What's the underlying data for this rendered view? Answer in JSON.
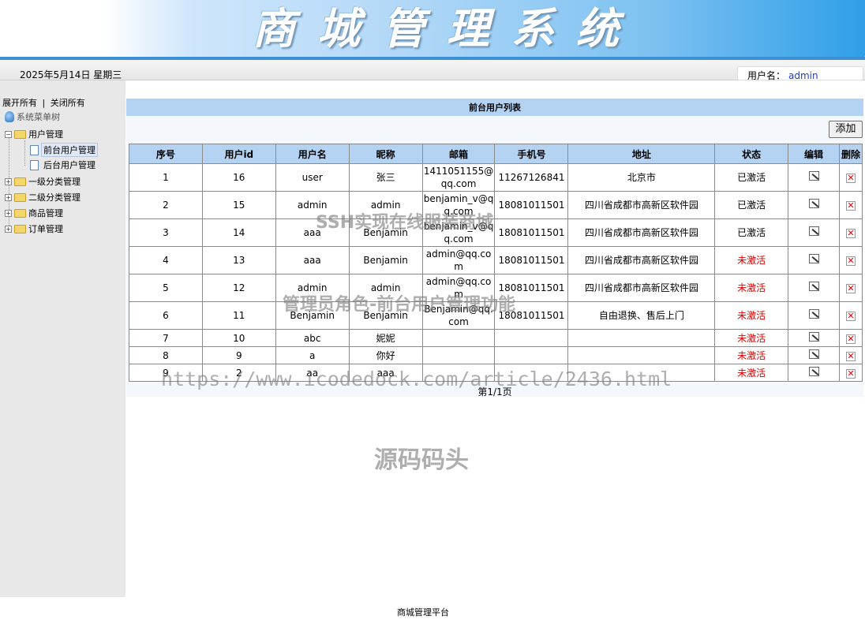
{
  "header": {
    "title": "商城管理系统"
  },
  "infobar": {
    "date": "2025年5月14日 星期三",
    "user_label": "用户名：",
    "username": "admin"
  },
  "sidebar": {
    "expand_all": "展开所有",
    "separator": "|",
    "collapse_all": "关闭所有",
    "root": "系统菜单树",
    "items": [
      {
        "label": "用户管理",
        "toggle": "−"
      },
      {
        "label": "前台用户管理"
      },
      {
        "label": "后台用户管理"
      },
      {
        "label": "一级分类管理",
        "toggle": "+"
      },
      {
        "label": "二级分类管理",
        "toggle": "+"
      },
      {
        "label": "商品管理",
        "toggle": "+"
      },
      {
        "label": "订单管理",
        "toggle": "+"
      }
    ]
  },
  "main": {
    "list_title": "前台用户列表",
    "add_button": "添加",
    "columns": [
      "序号",
      "用户id",
      "用户名",
      "昵称",
      "邮箱",
      "手机号",
      "地址",
      "状态",
      "编辑",
      "删除"
    ],
    "rows": [
      {
        "no": "1",
        "id": "16",
        "username": "user",
        "nickname": "张三",
        "email": "1411051155@qq.com",
        "phone": "11267126841",
        "address": "北京市",
        "status": "已激活",
        "active": true
      },
      {
        "no": "2",
        "id": "15",
        "username": "admin",
        "nickname": "admin",
        "email": "benjamin_v@qq.com",
        "phone": "18081011501",
        "address": "四川省成都市高新区软件园",
        "status": "已激活",
        "active": true
      },
      {
        "no": "3",
        "id": "14",
        "username": "aaa",
        "nickname": "Benjamin",
        "email": "benjamin_v@qq.com",
        "phone": "18081011501",
        "address": "四川省成都市高新区软件园",
        "status": "已激活",
        "active": true
      },
      {
        "no": "4",
        "id": "13",
        "username": "aaa",
        "nickname": "Benjamin",
        "email": "admin@qq.com",
        "phone": "18081011501",
        "address": "四川省成都市高新区软件园",
        "status": "未激活",
        "active": false
      },
      {
        "no": "5",
        "id": "12",
        "username": "admin",
        "nickname": "admin",
        "email": "admin@qq.com",
        "phone": "18081011501",
        "address": "四川省成都市高新区软件园",
        "status": "未激活",
        "active": false
      },
      {
        "no": "6",
        "id": "11",
        "username": "Benjamin",
        "nickname": "Benjamin",
        "email": "Benjamin@qq.com",
        "phone": "18081011501",
        "address": "自由退换、售后上门",
        "status": "未激活",
        "active": false
      },
      {
        "no": "7",
        "id": "10",
        "username": "abc",
        "nickname": "妮妮",
        "email": "",
        "phone": "",
        "address": "",
        "status": "未激活",
        "active": false
      },
      {
        "no": "8",
        "id": "9",
        "username": "a",
        "nickname": "你好",
        "email": "",
        "phone": "",
        "address": "",
        "status": "未激活",
        "active": false
      },
      {
        "no": "9",
        "id": "2",
        "username": "aa",
        "nickname": "aaa",
        "email": "",
        "phone": "",
        "address": "",
        "status": "未激活",
        "active": false
      }
    ],
    "pager": "第1/1页"
  },
  "watermarks": {
    "line1": "SSH实现在线服装商城",
    "line2": "管理员角色-前台用户管理功能",
    "line3": "https://www.icodedock.com/article/2436.html",
    "line4": "源码码头"
  },
  "footer": {
    "text": "商城管理平台"
  },
  "colors": {
    "header_blue": "#b4d3f2",
    "status_inactive": "#e00000",
    "username_link": "#1f3cc2"
  }
}
